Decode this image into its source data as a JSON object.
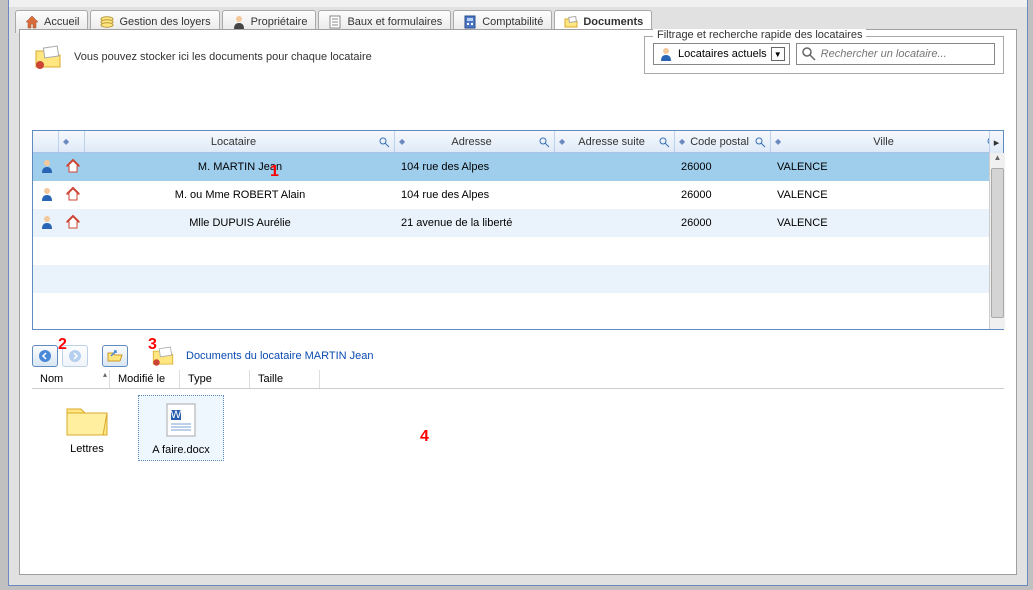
{
  "tabs": [
    {
      "label": "Accueil"
    },
    {
      "label": "Gestion des loyers"
    },
    {
      "label": "Propriétaire"
    },
    {
      "label": "Baux et formulaires"
    },
    {
      "label": "Comptabilité"
    },
    {
      "label": "Documents"
    }
  ],
  "info_text": "Vous pouvez stocker ici les documents pour chaque locataire",
  "filter": {
    "title": "Filtrage et recherche rapide des locataires",
    "dropdown": "Locataires actuels",
    "search_placeholder": "Rechercher un locataire..."
  },
  "grid": {
    "headers": {
      "locataire": "Locataire",
      "adresse": "Adresse",
      "suite": "Adresse suite",
      "cp": "Code postal",
      "ville": "Ville"
    },
    "rows": [
      {
        "name": "M. MARTIN Jean",
        "addr": "104 rue des Alpes",
        "suite": "",
        "cp": "26000",
        "ville": "VALENCE"
      },
      {
        "name": "M. ou Mme ROBERT Alain",
        "addr": "104 rue des Alpes",
        "suite": "",
        "cp": "26000",
        "ville": "VALENCE"
      },
      {
        "name": "Mlle DUPUIS Aurélie",
        "addr": "21 avenue de la liberté",
        "suite": "",
        "cp": "26000",
        "ville": "VALENCE"
      }
    ]
  },
  "lower": {
    "path_title": "Documents du locataire MARTIN Jean",
    "headers": {
      "nom": "Nom",
      "modif": "Modifié le",
      "type": "Type",
      "taille": "Taille"
    },
    "items": [
      {
        "label": "Lettres",
        "kind": "folder"
      },
      {
        "label": "A faire.docx",
        "kind": "word"
      }
    ]
  },
  "annotations": {
    "a1": "1",
    "a2": "2",
    "a3": "3",
    "a4": "4"
  }
}
